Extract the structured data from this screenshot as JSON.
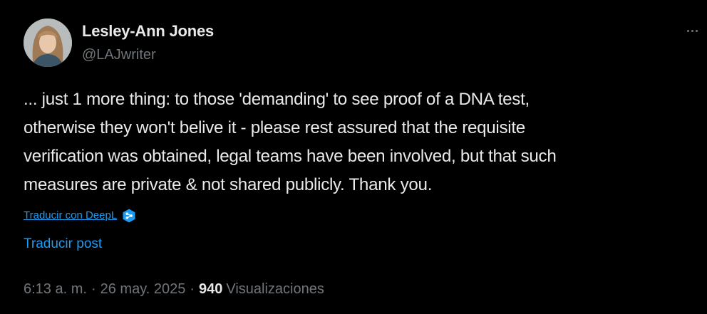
{
  "author": {
    "display_name": "Lesley-Ann Jones",
    "handle": "@LAJwriter"
  },
  "tweet": {
    "text": "... just 1 more thing: to those 'demanding' to see proof of a DNA test,\notherwise they won't belive it - please rest assured that the requisite\nverification was obtained, legal teams have been involved, but that such\nmeasures are private & not shared publicly. Thank you."
  },
  "actions": {
    "translate_deepl": "Traducir con DeepL",
    "translate_post": "Traducir post"
  },
  "meta": {
    "time": "6:13 a. m.",
    "separator": "·",
    "date": "26 may. 2025",
    "views_count": "940",
    "views_label": "Visualizaciones"
  },
  "icons": {
    "more": "more-horizontal-icon",
    "deepl": "deepl-icon"
  },
  "colors": {
    "background": "#000000",
    "text": "#e7e9ea",
    "secondary": "#71767b",
    "link": "#1d9bf0"
  }
}
